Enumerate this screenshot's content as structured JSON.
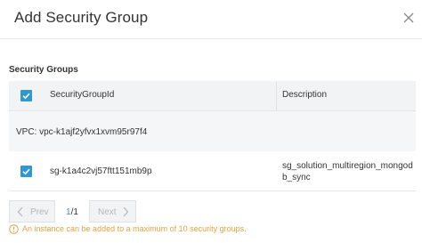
{
  "dialog": {
    "title": "Add Security Group",
    "close_icon": "close-icon"
  },
  "section": {
    "label": "Security Groups"
  },
  "table": {
    "select_all_checked": true,
    "columns": [
      "SecurityGroupId",
      "Description"
    ],
    "vpc_label": "VPC: vpc-k1ajf2yfvx1xvm95r97f4",
    "rows": [
      {
        "checked": true,
        "security_group_id": "sg-k1a4c2vj57ftt151mb9p",
        "description": "sg_solution_multiregion_mongodb_sync"
      }
    ]
  },
  "pagination": {
    "prev_label": "Prev",
    "next_label": "Next",
    "current_page": "1",
    "total_pages": "1",
    "prev_disabled": true,
    "next_disabled": true
  },
  "notice": {
    "icon": "info-circle-icon",
    "text": "An instance can be added to a maximum of 10 security groups."
  },
  "colors": {
    "accent": "#2f97d3",
    "warning": "#e6a23c",
    "header_bg": "#f2f3f5",
    "group_row_bg": "#f5f6f7"
  }
}
